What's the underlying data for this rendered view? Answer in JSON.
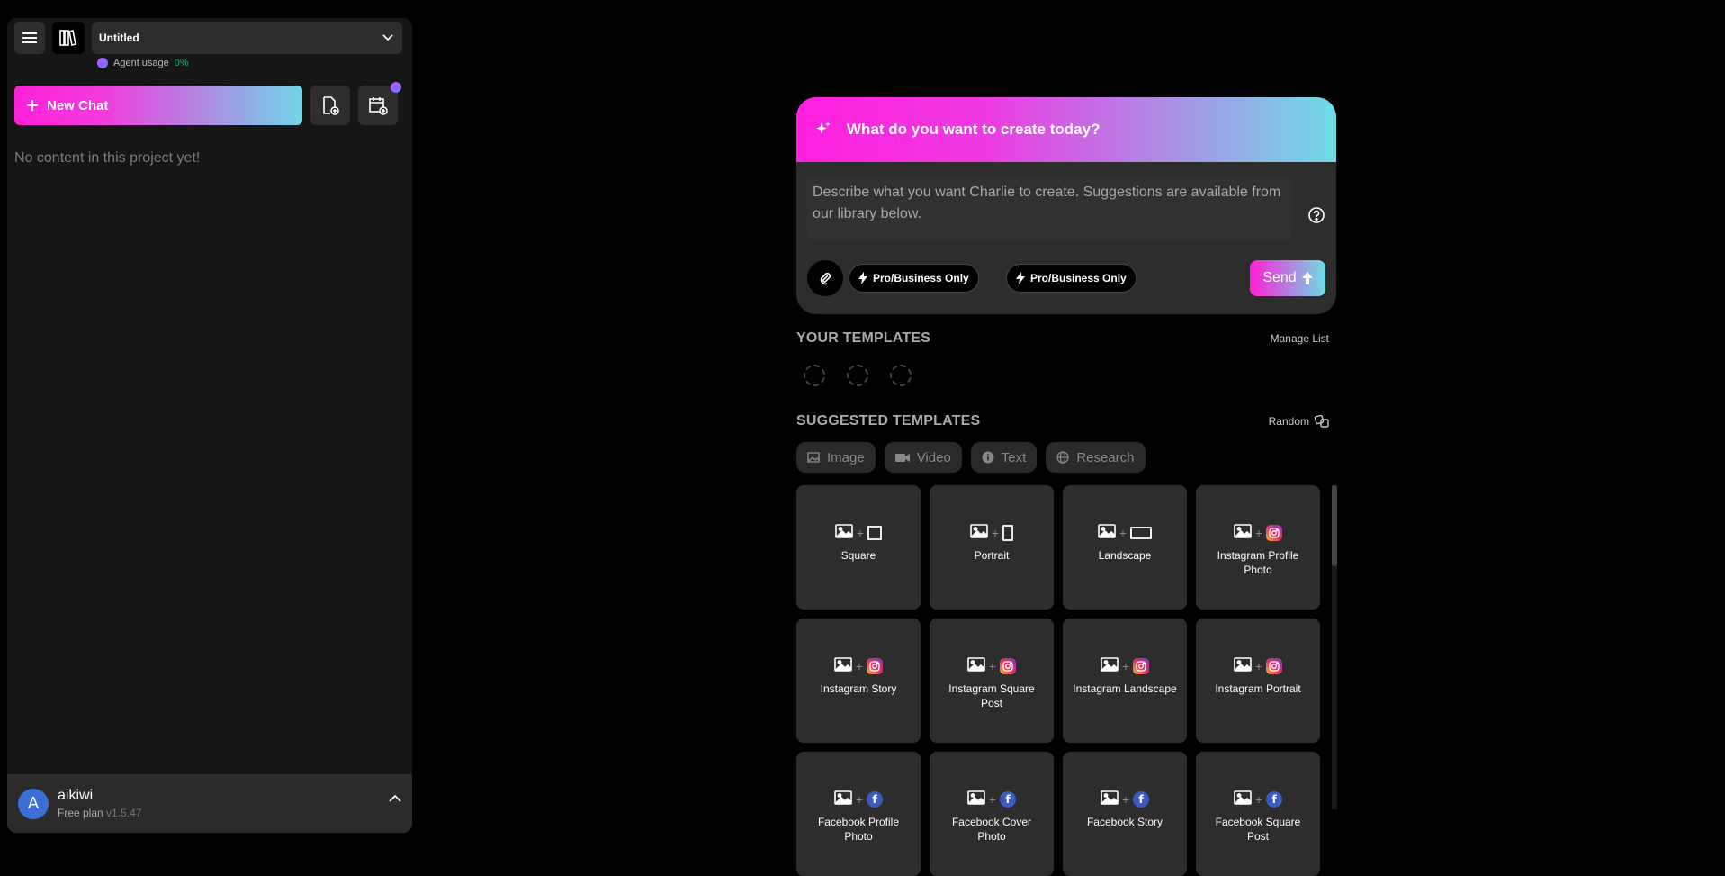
{
  "sidebar": {
    "project_title": "Untitled",
    "agent_usage_label": "Agent usage",
    "agent_usage_pct": "0%",
    "new_chat_label": "New Chat",
    "empty_message": "No content in this project yet!",
    "user": {
      "initial": "A",
      "name": "aikiwi",
      "plan": "Free plan",
      "version": "v1.5.47"
    }
  },
  "composer": {
    "heading": "What do you want to create today?",
    "placeholder": "Describe what you want Charlie to create. Suggestions are available from our library below.",
    "pill1_label": "Pro/Business Only",
    "pill2_label": "Pro/Business Only",
    "send_label": "Send"
  },
  "your_templates": {
    "title": "YOUR TEMPLATES",
    "manage_label": "Manage List"
  },
  "suggested": {
    "title": "SUGGESTED TEMPLATES",
    "random_label": "Random",
    "filters": [
      "Image",
      "Video",
      "Text",
      "Research"
    ],
    "cards": [
      {
        "label": "Square",
        "icon": "square"
      },
      {
        "label": "Portrait",
        "icon": "portrait"
      },
      {
        "label": "Landscape",
        "icon": "landscape"
      },
      {
        "label": "Instagram Profile Photo",
        "icon": "instagram"
      },
      {
        "label": "Instagram Story",
        "icon": "instagram"
      },
      {
        "label": "Instagram Square Post",
        "icon": "instagram"
      },
      {
        "label": "Instagram Landscape",
        "icon": "instagram"
      },
      {
        "label": "Instagram Portrait",
        "icon": "instagram"
      },
      {
        "label": "Facebook Profile Photo",
        "icon": "facebook"
      },
      {
        "label": "Facebook Cover Photo",
        "icon": "facebook"
      },
      {
        "label": "Facebook Story",
        "icon": "facebook"
      },
      {
        "label": "Facebook Square Post",
        "icon": "facebook"
      }
    ]
  },
  "colors": {
    "accent_pink": "#ff1fd7",
    "accent_cyan": "#6fdce6",
    "panel": "#2d2d2d",
    "background": "#000000"
  }
}
